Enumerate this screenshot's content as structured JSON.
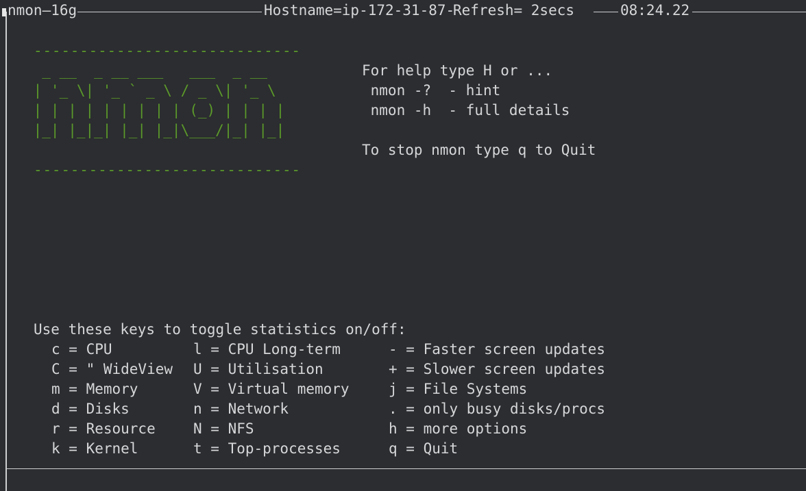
{
  "header": {
    "app": "nmon—16g",
    "hostname": "Hostname=ip-172-31-87-",
    "refresh": "Refresh= 2secs ",
    "time": "08:24.22"
  },
  "banner": {
    "rule": "-----------------------------",
    "art": [
      "  _ __  _ __ ___   ___  _ __  ",
      " | '_ \\| '_ ` _ \\ / _ \\| '_ \\ ",
      " | | | | | | | | | (_) | | | |",
      " |_| |_|_| |_| |_|\\___/|_| |_|"
    ]
  },
  "help": {
    "line1": "For help type H or ...",
    "line2": " nmon -?  - hint",
    "line3": " nmon -h  - full details",
    "line4": "To stop nmon type q to Quit"
  },
  "keys": {
    "heading": "Use these keys to toggle statistics on/off:",
    "col1": [
      "c = CPU",
      "C = \" WideView",
      "m = Memory",
      "d = Disks",
      "r = Resource",
      "k = Kernel"
    ],
    "col2": [
      "l = CPU Long-term",
      "U = Utilisation",
      "V = Virtual memory",
      "n = Network",
      "N = NFS",
      "t = Top-processes"
    ],
    "col3": [
      "- = Faster screen updates",
      "+ = Slower screen updates",
      "j = File Systems",
      ". = only busy disks/procs",
      "h = more options",
      "q = Quit"
    ]
  },
  "colors": {
    "background": "#2b2d30",
    "text": "#d6d7d9",
    "banner": "#5c9a2a"
  }
}
